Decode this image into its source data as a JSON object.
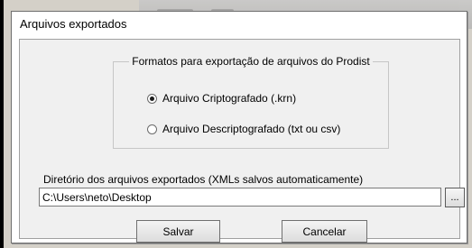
{
  "dialog": {
    "title": "Arquivos exportados"
  },
  "formats_group": {
    "legend": "Formatos para exportação de arquivos do Prodist",
    "options": [
      {
        "label": "Arquivo Criptografado (.krn)",
        "selected": true
      },
      {
        "label": "Arquivo Descriptografado (txt ou csv)",
        "selected": false
      }
    ]
  },
  "directory": {
    "label": "Diretório dos arquivos exportados (XMLs salvos automaticamente)",
    "value": "C:\\Users\\neto\\Desktop",
    "browse_label": "..."
  },
  "buttons": {
    "save_label": "Salvar",
    "cancel_label": "Cancelar"
  }
}
